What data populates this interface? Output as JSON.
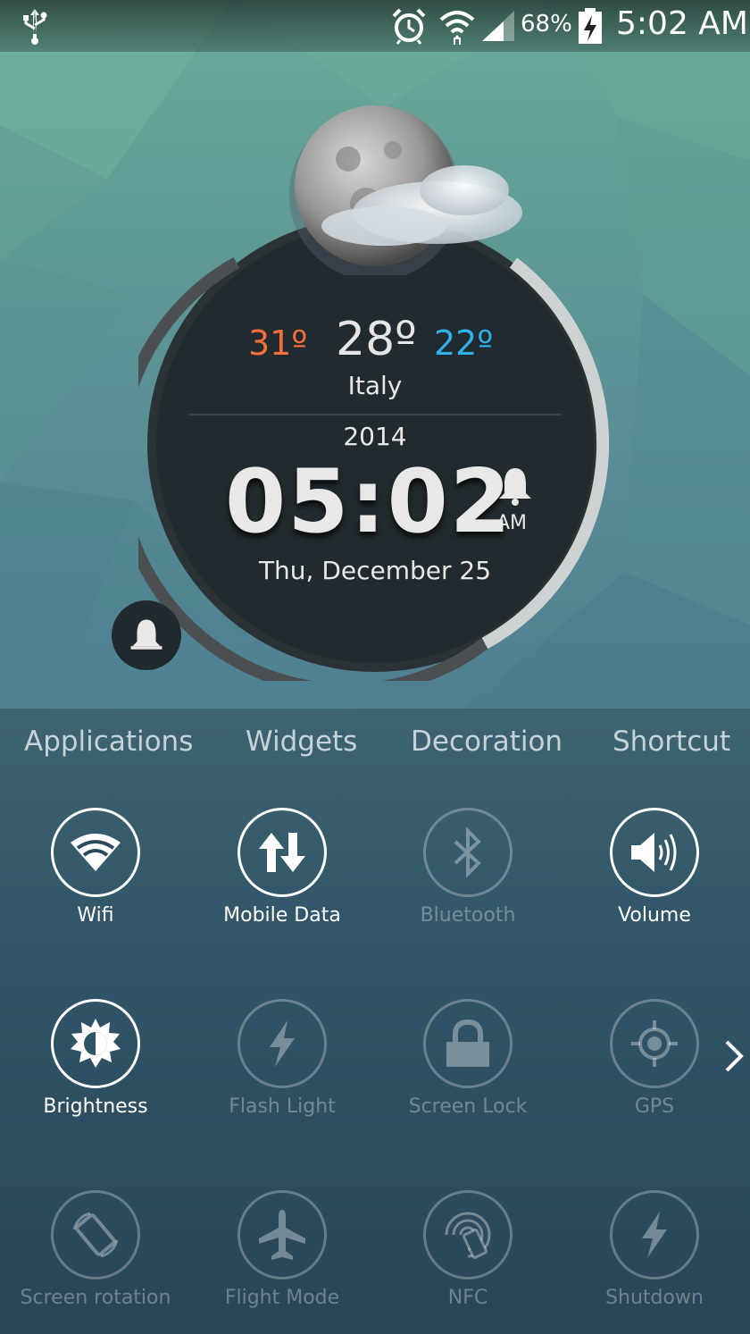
{
  "status_bar": {
    "battery_percent": "68%",
    "time": "5:02 AM",
    "icons": [
      "usb-icon",
      "alarm-clock-icon",
      "wifi-icon",
      "signal-icon",
      "battery-charging-icon"
    ]
  },
  "weather": {
    "high": "31º",
    "current": "28º",
    "low": "22º",
    "city": "Italy",
    "condition_icon": "moon-cloud-icon",
    "colors": {
      "high": "#f36f3a",
      "low": "#2fb0ea"
    }
  },
  "clock": {
    "year": "2014",
    "time": "05:02",
    "ampm": "AM",
    "date": "Thu, December 25",
    "alarm_icon": "bell-icon"
  },
  "tabs": [
    "Applications",
    "Widgets",
    "Decoration",
    "Shortcut"
  ],
  "toggles": [
    {
      "label": "Wifi",
      "icon": "wifi-icon",
      "active": true
    },
    {
      "label": "Mobile Data",
      "icon": "mobile-data-icon",
      "active": true
    },
    {
      "label": "Bluetooth",
      "icon": "bluetooth-icon",
      "active": false
    },
    {
      "label": "Volume",
      "icon": "volume-icon",
      "active": true
    },
    {
      "label": "Brightness",
      "icon": "brightness-icon",
      "active": true
    },
    {
      "label": "Flash Light",
      "icon": "flash-icon",
      "active": false
    },
    {
      "label": "Screen Lock",
      "icon": "lock-icon",
      "active": false
    },
    {
      "label": "GPS",
      "icon": "gps-icon",
      "active": false
    },
    {
      "label": "Screen rotation",
      "icon": "rotation-icon",
      "active": false
    },
    {
      "label": "Flight Mode",
      "icon": "airplane-icon",
      "active": false
    },
    {
      "label": "NFC",
      "icon": "nfc-icon",
      "active": false
    },
    {
      "label": "Shutdown",
      "icon": "shutdown-icon",
      "active": false
    }
  ]
}
